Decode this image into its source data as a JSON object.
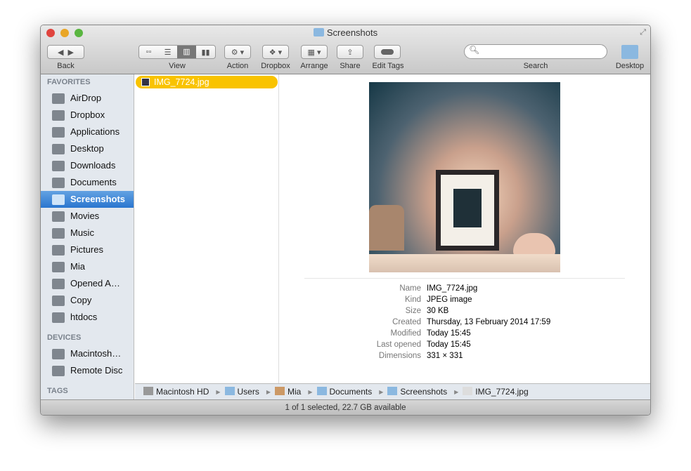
{
  "window": {
    "title": "Screenshots"
  },
  "toolbar": {
    "back": "Back",
    "view": "View",
    "action": "Action",
    "dropbox": "Dropbox",
    "arrange": "Arrange",
    "share": "Share",
    "edit_tags": "Edit Tags",
    "search": "Search",
    "desktop": "Desktop",
    "search_placeholder": ""
  },
  "sidebar": {
    "favorites_header": "FAVORITES",
    "favorites": [
      "AirDrop",
      "Dropbox",
      "Applications",
      "Desktop",
      "Downloads",
      "Documents",
      "Screenshots",
      "Movies",
      "Music",
      "Pictures",
      "Mia",
      "Opened A…",
      "Copy",
      "htdocs"
    ],
    "selected": "Screenshots",
    "devices_header": "DEVICES",
    "devices": [
      "Macintosh…",
      "Remote Disc"
    ],
    "tags_header": "TAGS"
  },
  "column": {
    "selected_file": "IMG_7724.jpg"
  },
  "info": {
    "rows": [
      [
        "Name",
        "IMG_7724.jpg"
      ],
      [
        "Kind",
        "JPEG image"
      ],
      [
        "Size",
        "30 KB"
      ],
      [
        "Created",
        "Thursday, 13 February 2014 17:59"
      ],
      [
        "Modified",
        "Today 15:45"
      ],
      [
        "Last opened",
        "Today 15:45"
      ],
      [
        "Dimensions",
        "331 × 331"
      ]
    ]
  },
  "path": [
    "Macintosh HD",
    "Users",
    "Mia",
    "Documents",
    "Screenshots",
    "IMG_7724.jpg"
  ],
  "status": "1 of 1 selected, 22.7 GB available"
}
